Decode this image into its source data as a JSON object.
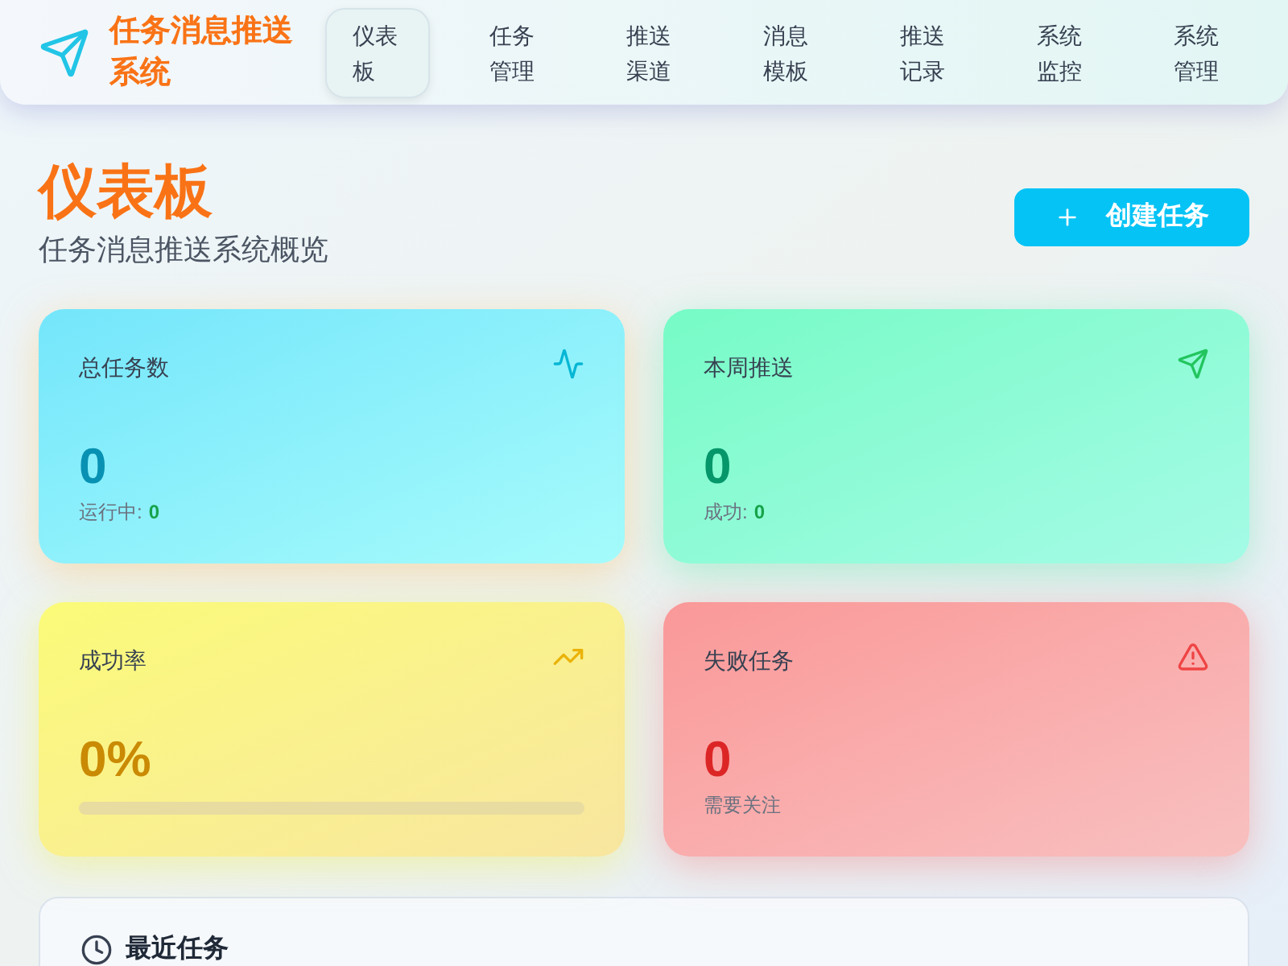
{
  "app": {
    "title": "任务消息推送系统"
  },
  "nav": [
    {
      "label": "仪表板",
      "selected": true
    },
    {
      "label": "任务管理",
      "selected": false
    },
    {
      "label": "推送渠道",
      "selected": false
    },
    {
      "label": "消息模板",
      "selected": false
    },
    {
      "label": "推送记录",
      "selected": false
    },
    {
      "label": "系统监控",
      "selected": false
    },
    {
      "label": "系统管理",
      "selected": false
    }
  ],
  "page": {
    "title": "仪表板",
    "subtitle": "任务消息推送系统概览",
    "create_button": "创建任务"
  },
  "stats": [
    {
      "kind": "total",
      "label": "总任务数",
      "value": "0",
      "sub_label": "运行中:",
      "sub_value": "0"
    },
    {
      "kind": "week",
      "label": "本周推送",
      "value": "0",
      "sub_label": "成功:",
      "sub_value": "0"
    },
    {
      "kind": "rate",
      "label": "成功率",
      "value": "0%",
      "level": 0
    },
    {
      "kind": "failed",
      "label": "失败任务",
      "value": "0",
      "sub_label": "需要关注"
    }
  ],
  "recent": {
    "title": "最近任务"
  }
}
